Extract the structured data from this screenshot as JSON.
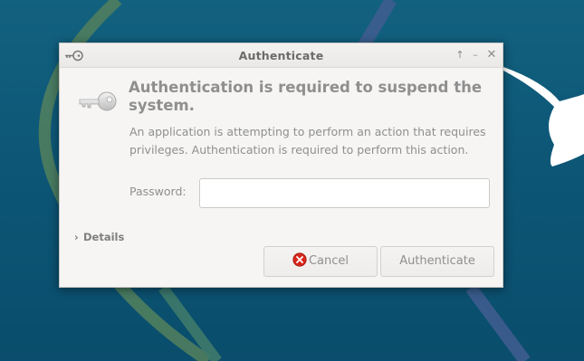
{
  "window": {
    "title": "Authenticate",
    "controls": [
      "up-arrow-icon",
      "minimize-icon",
      "close-icon"
    ]
  },
  "dialog": {
    "heading": "Authentication is required to suspend the system.",
    "message": "An application is attempting to perform an action that requires privileges. Authentication is required to perform this action.",
    "password_label": "Password:",
    "password_value": "",
    "details_label": "Details",
    "cancel_label": "Cancel",
    "authenticate_label": "Authenticate"
  },
  "icons": {
    "dialog_icon": "key-icon",
    "cancel_icon": "stop-icon"
  },
  "colors": {
    "desktop_bg": "#0e5a7a",
    "dialog_bg": "#f6f5f4",
    "cancel_icon_red": "#d9261c",
    "text_dim": "#8f8f8f"
  }
}
